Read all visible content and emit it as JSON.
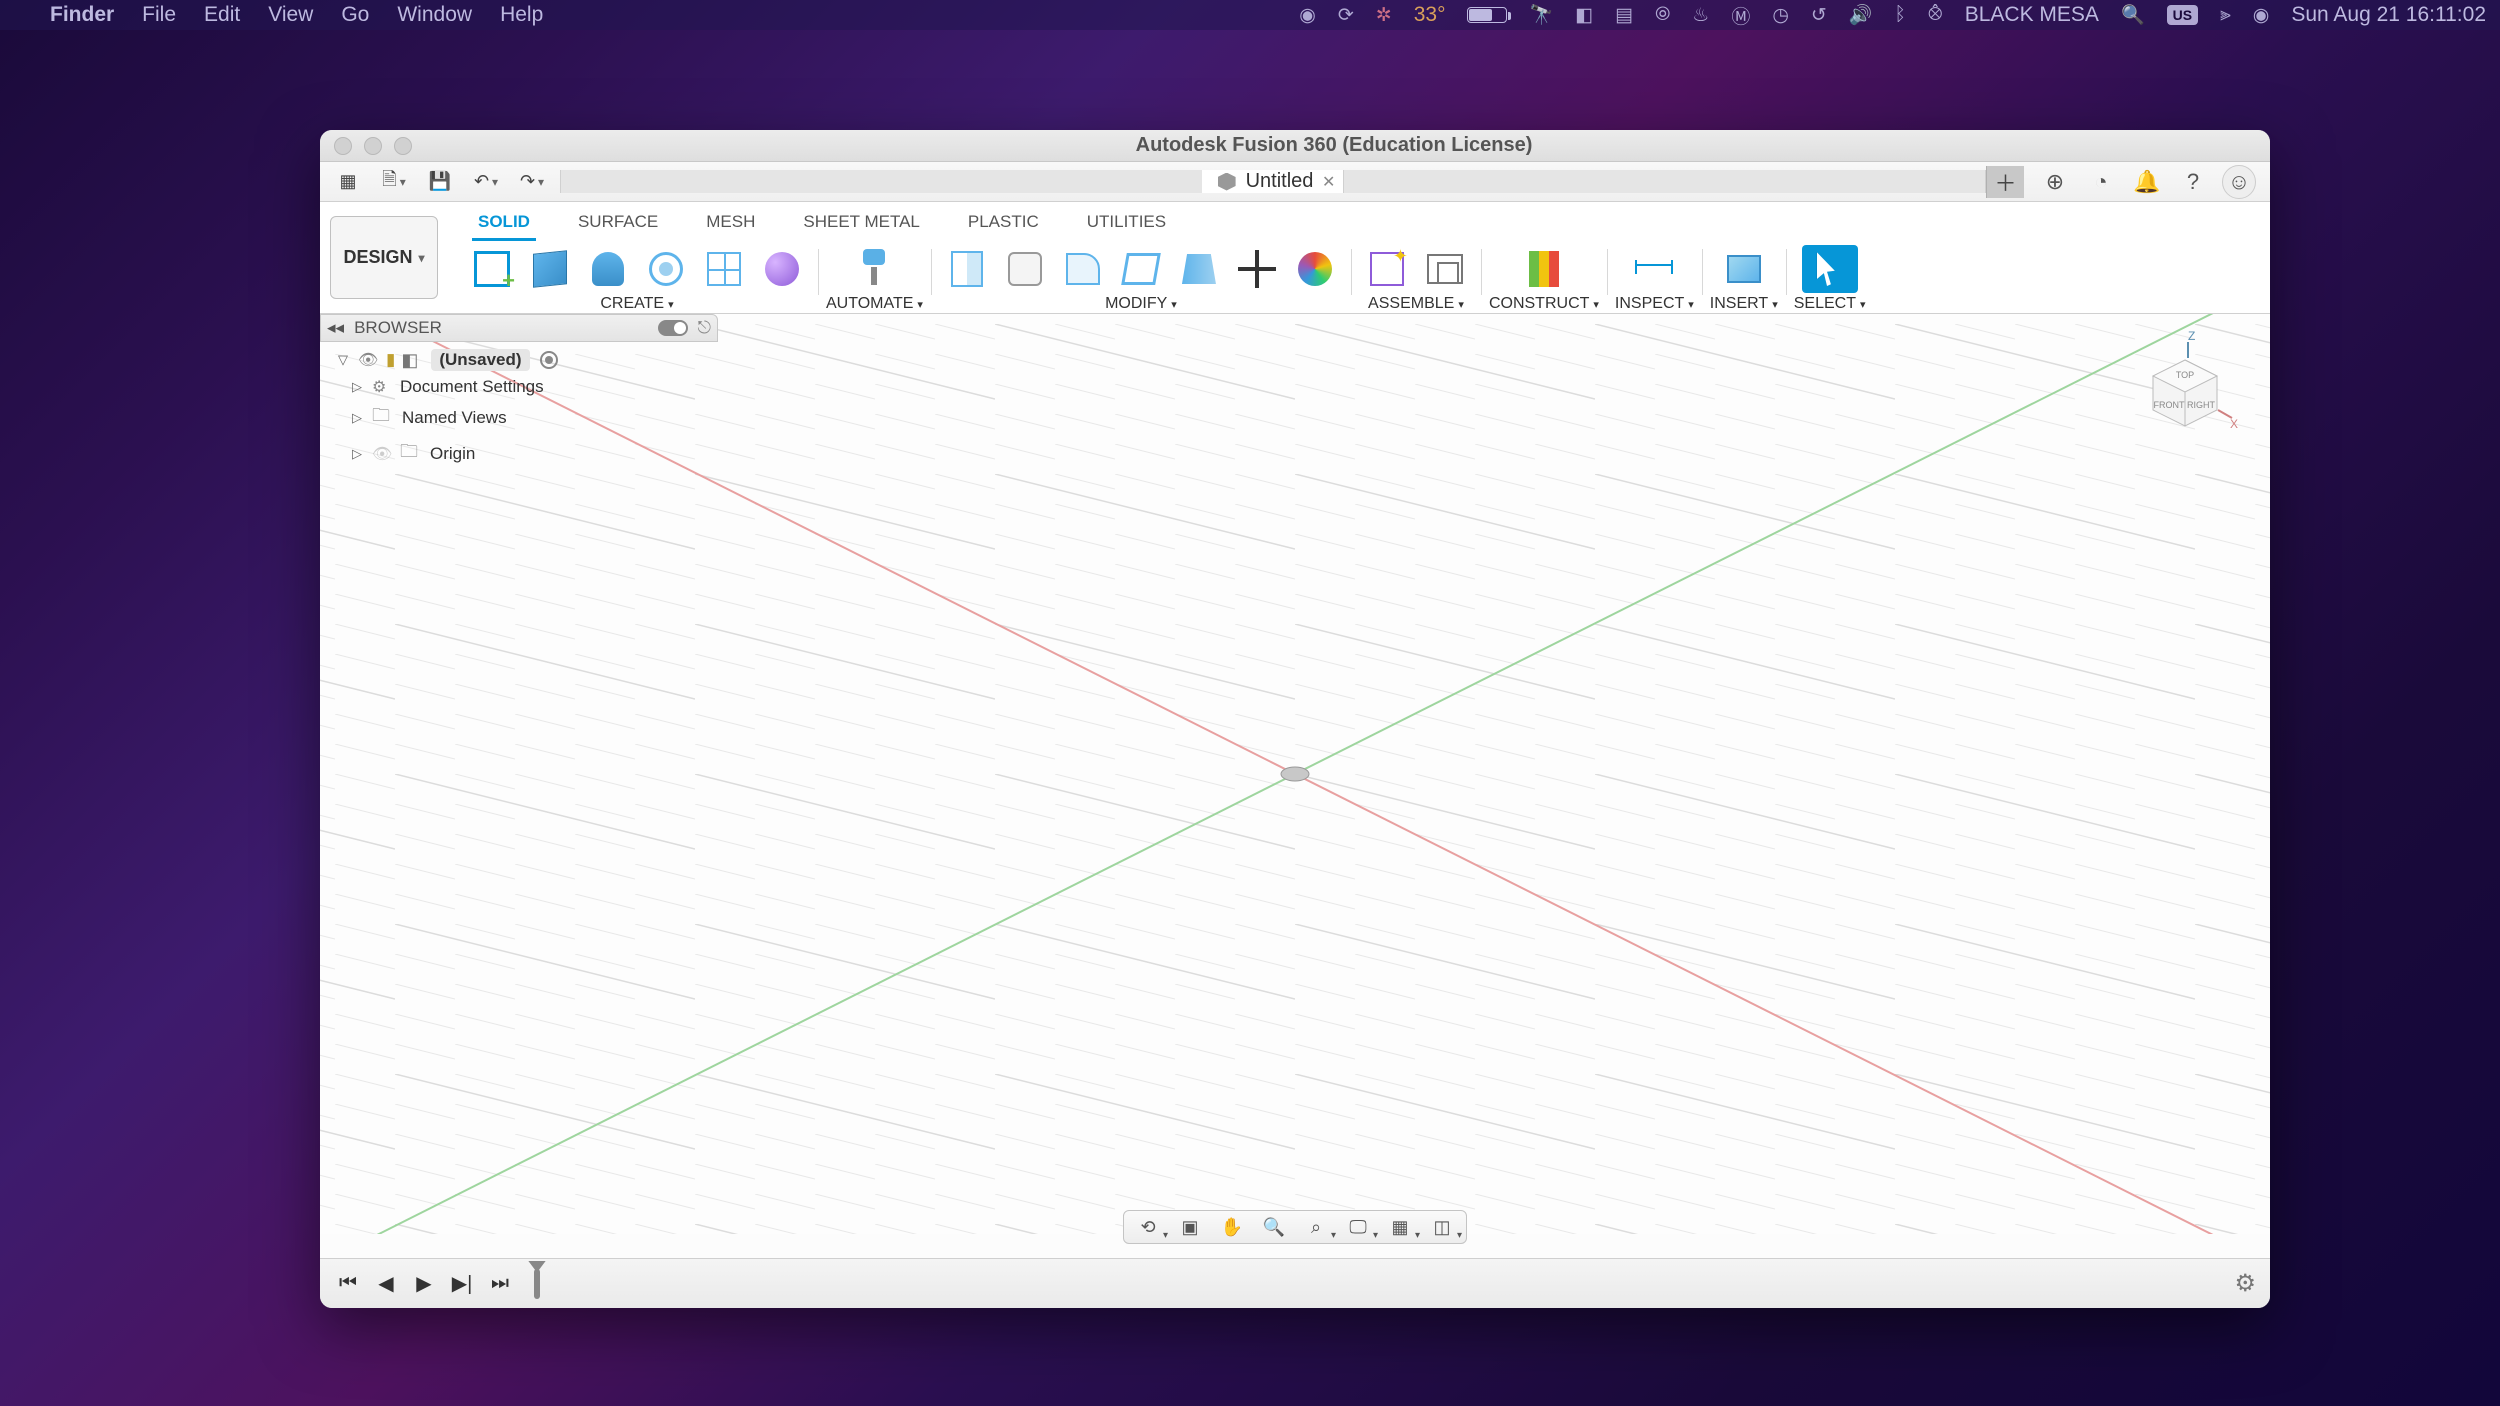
{
  "menubar": {
    "app": "Finder",
    "items": [
      "File",
      "Edit",
      "View",
      "Go",
      "Window",
      "Help"
    ],
    "temp": "33°",
    "host": "BLACK MESA",
    "datetime": "Sun Aug 21  16:11:02",
    "kb": "US"
  },
  "window": {
    "title": "Autodesk Fusion 360 (Education License)",
    "tab": "Untitled"
  },
  "workspace": "DESIGN",
  "ribbon": {
    "tabs": [
      "SOLID",
      "SURFACE",
      "MESH",
      "SHEET METAL",
      "PLASTIC",
      "UTILITIES"
    ],
    "active": 0,
    "groups": {
      "create": "CREATE",
      "automate": "AUTOMATE",
      "modify": "MODIFY",
      "assemble": "ASSEMBLE",
      "construct": "CONSTRUCT",
      "inspect": "INSPECT",
      "insert": "INSERT",
      "select": "SELECT"
    }
  },
  "browser": {
    "label": "BROWSER",
    "root": "(Unsaved)",
    "items": [
      "Document Settings",
      "Named Views",
      "Origin"
    ]
  },
  "viewcube": {
    "top": "TOP",
    "front": "FRONT",
    "right": "RIGHT",
    "z": "Z",
    "x": "X"
  }
}
